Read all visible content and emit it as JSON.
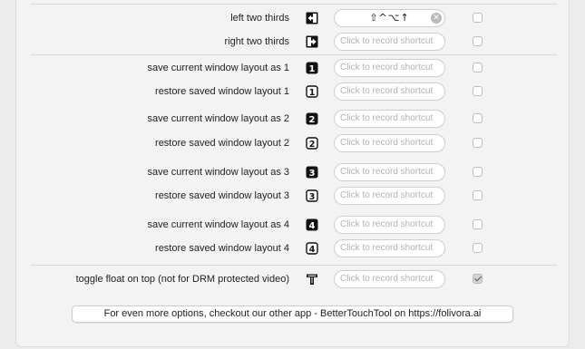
{
  "shortcut_placeholder": "Click to record shortcut",
  "rows": [
    {
      "label": "left two thirds",
      "icon": "snap-left-two-thirds-icon",
      "shortcut": "⇧^⌥↑",
      "enabled": false
    },
    {
      "label": "right two thirds",
      "icon": "snap-right-two-thirds-icon",
      "shortcut": "",
      "enabled": false
    },
    {
      "label": "save current window layout as 1",
      "icon": "filled-square-1-icon",
      "shortcut": "",
      "enabled": false
    },
    {
      "label": "restore saved window layout 1",
      "icon": "outlined-square-1-icon",
      "shortcut": "",
      "enabled": false
    },
    {
      "label": "save current window layout as 2",
      "icon": "filled-square-2-icon",
      "shortcut": "",
      "enabled": false
    },
    {
      "label": "restore saved window layout 2",
      "icon": "outlined-square-2-icon",
      "shortcut": "",
      "enabled": false
    },
    {
      "label": "save current window layout as 3",
      "icon": "filled-square-3-icon",
      "shortcut": "",
      "enabled": false
    },
    {
      "label": "restore saved window layout 3",
      "icon": "outlined-square-3-icon",
      "shortcut": "",
      "enabled": false
    },
    {
      "label": "save current window layout as 4",
      "icon": "filled-square-4-icon",
      "shortcut": "",
      "enabled": false
    },
    {
      "label": "restore saved window layout 4",
      "icon": "outlined-square-4-icon",
      "shortcut": "",
      "enabled": false
    },
    {
      "label": "toggle float on top (not for DRM protected video)",
      "icon": "float-on-top-icon",
      "shortcut": "",
      "enabled": true
    }
  ],
  "bottom_button_label": "For even more options, checkout our other app - BetterTouchTool on https://folivora.ai"
}
